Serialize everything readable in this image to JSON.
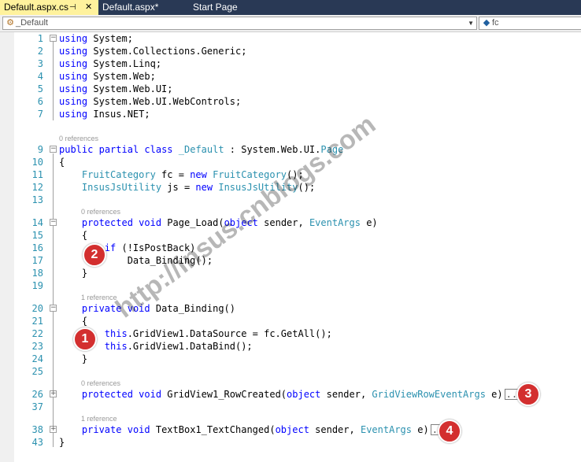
{
  "tabs": [
    {
      "label": "Default.aspx.cs",
      "pin": "⊣",
      "close": "✕"
    },
    {
      "label": "Default.aspx*"
    },
    {
      "label": "Start Page"
    }
  ],
  "nav": {
    "class_combo": "_Default",
    "member_combo": "fc"
  },
  "lines": {
    "l1": {
      "num": "1",
      "code": "using System;"
    },
    "l2": {
      "num": "2",
      "code": "using System.Collections.Generic;"
    },
    "l3": {
      "num": "3",
      "code": "using System.Linq;"
    },
    "l4": {
      "num": "4",
      "code": "using System.Web;"
    },
    "l5": {
      "num": "5",
      "code": "using System.Web.UI;"
    },
    "l6": {
      "num": "6",
      "code": "using System.Web.UI.WebControls;"
    },
    "l7": {
      "num": "7",
      "code": "using Insus.NET;"
    },
    "lens9": "0 references",
    "l9": {
      "num": "9",
      "code": "public partial class _Default : System.Web.UI.Page"
    },
    "l10": {
      "num": "10",
      "code": "{"
    },
    "l11": {
      "num": "11",
      "code": "    FruitCategory fc = new FruitCategory();"
    },
    "l12": {
      "num": "12",
      "code": "    InsusJsUtility js = new InsusJsUtility();"
    },
    "l13": {
      "num": "13",
      "code": ""
    },
    "lens14": "0 references",
    "l14": {
      "num": "14",
      "code": "    protected void Page_Load(object sender, EventArgs e)"
    },
    "l15": {
      "num": "15",
      "code": "    {"
    },
    "l16": {
      "num": "16",
      "code": "        if (!IsPostBack)"
    },
    "l17": {
      "num": "17",
      "code": "            Data_Binding();"
    },
    "l18": {
      "num": "18",
      "code": "    }"
    },
    "l19": {
      "num": "19",
      "code": ""
    },
    "lens20": "1 reference",
    "l20": {
      "num": "20",
      "code": "    private void Data_Binding()"
    },
    "l21": {
      "num": "21",
      "code": "    {"
    },
    "l22": {
      "num": "22",
      "code": "        this.GridView1.DataSource = fc.GetAll();"
    },
    "l23": {
      "num": "23",
      "code": "        this.GridView1.DataBind();"
    },
    "l24": {
      "num": "24",
      "code": "    }"
    },
    "l25": {
      "num": "25",
      "code": ""
    },
    "lens26": "0 references",
    "l26": {
      "num": "26",
      "code": "    protected void GridView1_RowCreated(object sender, GridViewRowEventArgs e)"
    },
    "l37": {
      "num": "37",
      "code": ""
    },
    "lens38": "1 reference",
    "l38": {
      "num": "38",
      "code": "    private void TextBox1_TextChanged(object sender, EventArgs e)"
    },
    "l43": {
      "num": "43",
      "code": "}"
    }
  },
  "collapsed_marker": "...",
  "annotations": [
    "1",
    "2",
    "3",
    "4"
  ],
  "watermark": "http://insus.cnblogs.com",
  "colors": {
    "keyword": "#0000ff",
    "type": "#2b91af",
    "line_number": "#2b91af",
    "badge": "#d32f2f",
    "active_tab": "#fff29d",
    "tab_strip": "#293955"
  }
}
